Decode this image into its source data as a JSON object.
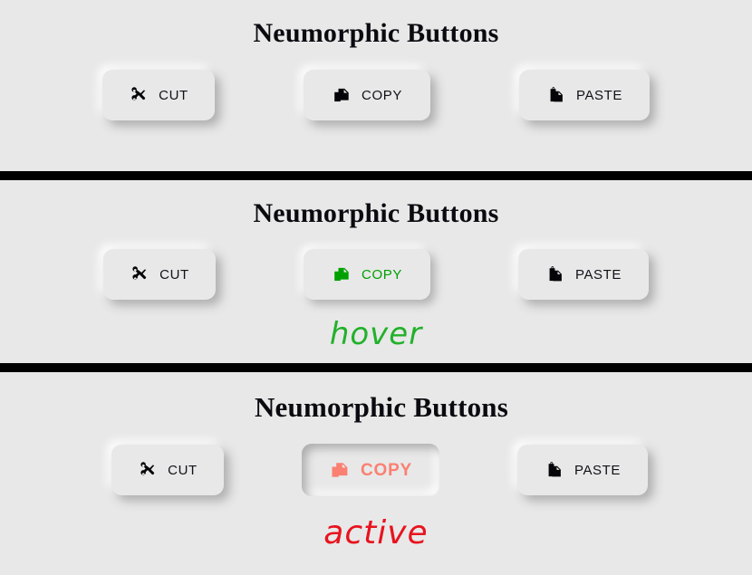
{
  "theme": {
    "background": "#e8e8e8",
    "button_background": "#e8e8e8",
    "divider_color": "#000000",
    "text_color": "#111118",
    "hover_color": "#00a000",
    "active_color": "#fa8072",
    "caption_hover_color": "#22b12a",
    "caption_active_color": "#e8131e"
  },
  "sections": [
    {
      "title": "Neumorphic Buttons",
      "state": "default",
      "buttons": [
        {
          "label": "CUT",
          "icon": "scissors-icon"
        },
        {
          "label": "COPY",
          "icon": "copy-icon"
        },
        {
          "label": "PASTE",
          "icon": "clipboard-paste-icon"
        }
      ],
      "caption": ""
    },
    {
      "title": "Neumorphic Buttons",
      "state": "hover",
      "buttons": [
        {
          "label": "CUT",
          "icon": "scissors-icon"
        },
        {
          "label": "COPY",
          "icon": "copy-icon"
        },
        {
          "label": "PASTE",
          "icon": "clipboard-paste-icon"
        }
      ],
      "caption": "hover"
    },
    {
      "title": "Neumorphic Buttons",
      "state": "active",
      "buttons": [
        {
          "label": "CUT",
          "icon": "scissors-icon"
        },
        {
          "label": "COPY",
          "icon": "copy-icon"
        },
        {
          "label": "PASTE",
          "icon": "clipboard-paste-icon"
        }
      ],
      "caption": "active"
    }
  ]
}
